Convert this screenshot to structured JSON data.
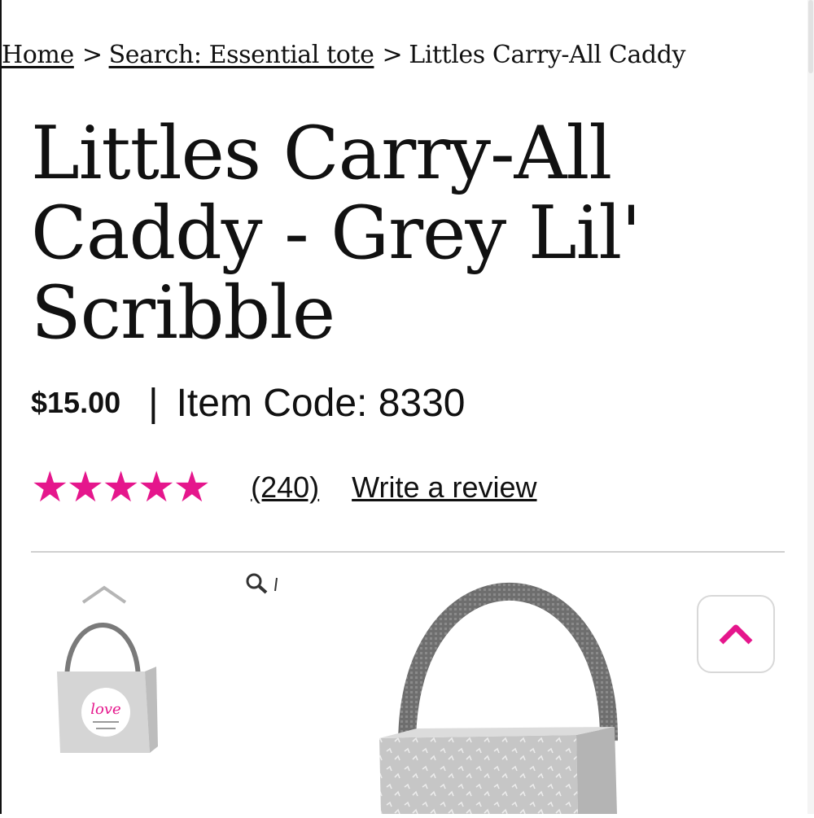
{
  "breadcrumb": {
    "home": "Home",
    "separator": ">",
    "search": "Search: Essential tote",
    "current": "Littles Carry-All Caddy"
  },
  "product": {
    "title": "Littles Carry-All Caddy - Grey Lil' Scribble",
    "price": "$15.00",
    "divider": "|",
    "item_code": "Item Code: 8330"
  },
  "rating": {
    "stars_glyphs": "★★★★★",
    "stars_value": 5,
    "stars_max": 5,
    "review_count": "(240)",
    "write_review": "Write a review"
  },
  "gallery": {
    "thumb_up_icon": "chevron-up-icon",
    "zoom_icon": "magnifier-icon",
    "thumbnail_badge_text": "love"
  },
  "back_to_top": {
    "icon": "chevron-up-icon"
  },
  "colors": {
    "accent": "#e5168c",
    "text": "#111111",
    "divider": "#cfcfcf",
    "product_grey": "#c9c9c9",
    "strap_grey": "#6e6e6e"
  }
}
